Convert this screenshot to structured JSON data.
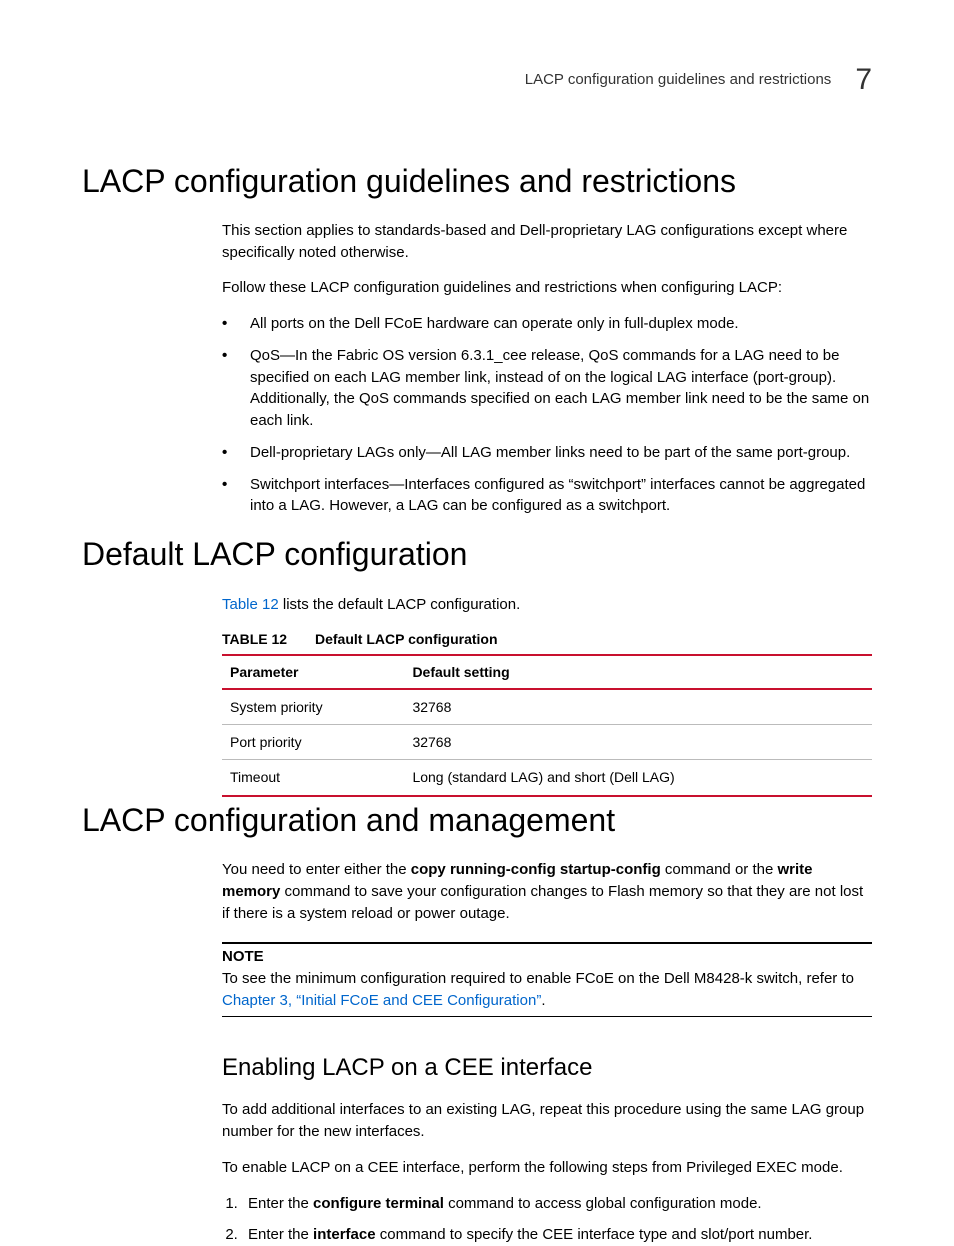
{
  "header": {
    "running_title": "LACP configuration guidelines and restrictions",
    "chapter_number": "7"
  },
  "sections": {
    "s1": {
      "title": "LACP configuration guidelines and restrictions",
      "p1": "This section applies to standards-based and Dell-proprietary LAG configurations except where specifically noted otherwise.",
      "p2": "Follow these LACP configuration guidelines and restrictions when configuring LACP:",
      "bullets": [
        "All ports on the Dell FCoE hardware can operate only in full-duplex mode.",
        "QoS—In the Fabric OS version 6.3.1_cee release, QoS commands for a LAG need to be specified on each LAG member link, instead of on the logical LAG interface (port-group). Additionally, the QoS commands specified on each LAG member link need to be the same on each link.",
        "Dell-proprietary LAGs only—All LAG member links need to be part of the same port-group.",
        "Switchport interfaces—Interfaces configured as “switchport” interfaces cannot be aggregated into a LAG. However, a LAG can be configured as a switchport."
      ]
    },
    "s2": {
      "title": "Default LACP configuration",
      "intro_link": "Table 12",
      "intro_rest": " lists the default LACP configuration.",
      "table": {
        "label": "TABLE 12",
        "title": "Default LACP configuration",
        "headers": [
          "Parameter",
          "Default setting"
        ],
        "rows": [
          [
            "System priority",
            "32768"
          ],
          [
            "Port priority",
            "32768"
          ],
          [
            "Timeout",
            "Long (standard LAG) and short (Dell LAG)"
          ]
        ]
      }
    },
    "s3": {
      "title": "LACP configuration and management",
      "p1_pre": "You need to enter either the ",
      "p1_cmd1": "copy running-config startup-config",
      "p1_mid": " command or the ",
      "p1_cmd2": "write memory",
      "p1_post": " command to save your configuration changes to Flash memory so that they are not lost if there is a system reload or power outage.",
      "note": {
        "label": "NOTE",
        "body_pre": "To see the minimum configuration required to enable FCoE on the Dell M8428-k switch, refer to ",
        "body_link": "Chapter 3, “Initial FCoE and CEE Configuration”",
        "body_post": "."
      },
      "sub": {
        "title": "Enabling LACP on a CEE interface",
        "p1": "To add additional interfaces to an existing LAG, repeat this procedure using the same LAG group number for the new interfaces.",
        "p2": "To enable LACP on a CEE interface, perform the following steps from Privileged EXEC mode.",
        "steps": {
          "s1_pre": "Enter the ",
          "s1_cmd": "configure terminal",
          "s1_post": " command to access global configuration mode.",
          "s2_pre": "Enter the ",
          "s2_cmd": "interface",
          "s2_post": " command to specify the CEE interface type and slot/port number."
        }
      }
    }
  }
}
